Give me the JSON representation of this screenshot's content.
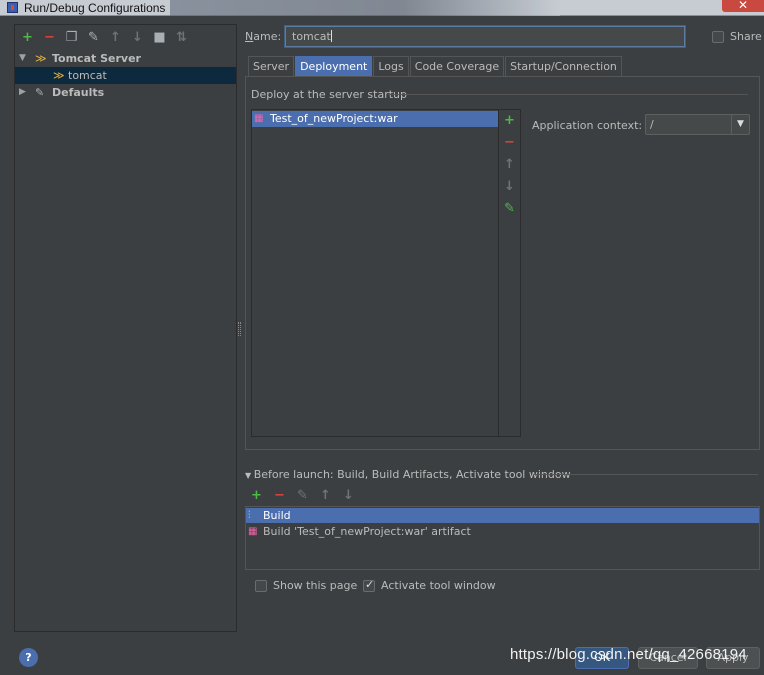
{
  "window": {
    "title": "Run/Debug Configurations",
    "close_label": "✕"
  },
  "left_toolbar": {
    "add_icon": "plus-icon",
    "remove_icon": "minus-icon",
    "copy_icon": "copy-icon",
    "edit_defaults_icon": "wrench-icon",
    "move_up_icon": "arrow-up-icon",
    "move_down_icon": "arrow-down-icon",
    "folder_icon": "folder-icon",
    "sort_icon": "sort-icon"
  },
  "tree": {
    "group_label": "Tomcat Server",
    "item_label": "tomcat",
    "defaults_label": "Defaults"
  },
  "name_field": {
    "label_prefix": "N",
    "label_rest": "ame:",
    "value": "tomcat"
  },
  "share": {
    "label": "Share",
    "checked": false
  },
  "tabs": [
    "Server",
    "Deployment",
    "Logs",
    "Code Coverage",
    "Startup/Connection"
  ],
  "active_tab": "Deployment",
  "deployment": {
    "section_title": "Deploy at the server startup",
    "artifacts": [
      "Test_of_newProject:war"
    ],
    "context_label": "Application context:",
    "context_value": "/"
  },
  "before_launch": {
    "title": "Before launch: Build, Build Artifacts, Activate tool window",
    "tasks": [
      "Build",
      "Build 'Test_of_newProject:war' artifact"
    ]
  },
  "options": {
    "show_page_label": "Show this page",
    "show_page_checked": false,
    "activate_label": "Activate tool window",
    "activate_checked": true
  },
  "footer": {
    "help_label": "?",
    "ok_label": "OK",
    "cancel_label": "Cancel",
    "apply_label": "Apply",
    "watermark": "https://blog.csdn.net/qq_42668194"
  },
  "colors": {
    "selection": "#4b6eaf",
    "add": "#4db948",
    "remove": "#e0433a",
    "tree_selection": "#0d293e"
  }
}
